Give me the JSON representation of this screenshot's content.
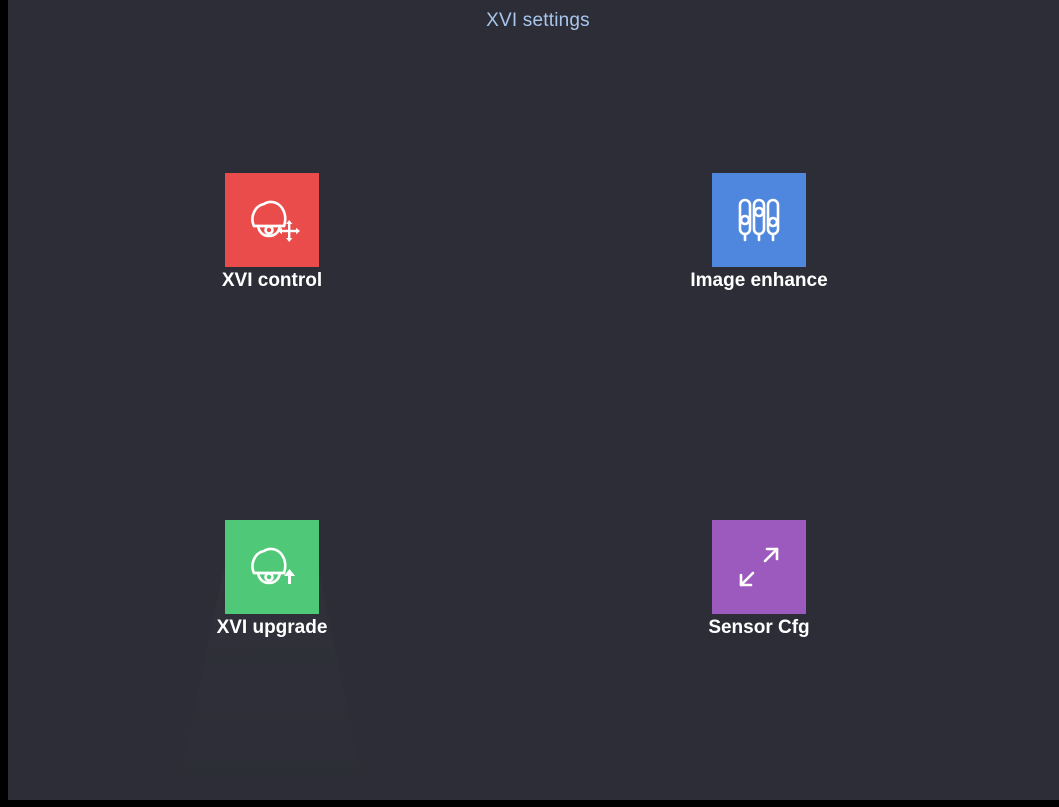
{
  "title": "XVI settings",
  "tiles": [
    {
      "label": "XVI control",
      "color": "#ea4b4b",
      "icon": "ptz-camera-move-icon"
    },
    {
      "label": "Image enhance",
      "color": "#4f86de",
      "icon": "equalizer-sliders-icon"
    },
    {
      "label": "XVI upgrade",
      "color": "#4fc877",
      "icon": "ptz-camera-upgrade-icon"
    },
    {
      "label": "Sensor Cfg",
      "color": "#9c59be",
      "icon": "expand-arrows-icon"
    }
  ]
}
